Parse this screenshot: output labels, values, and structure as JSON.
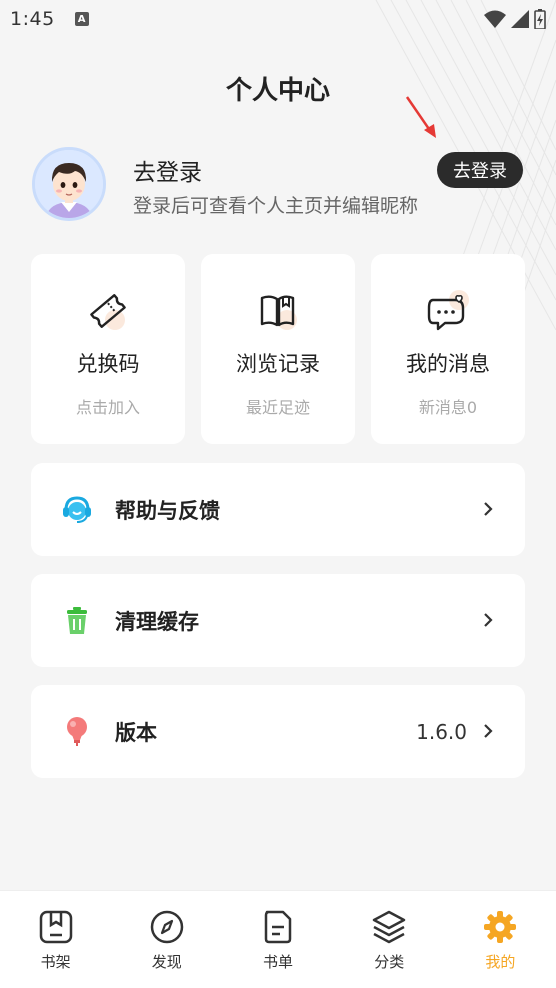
{
  "status": {
    "time": "1:45",
    "notif_letter": "A"
  },
  "header": {
    "title": "个人中心"
  },
  "profile": {
    "name": "去登录",
    "subtitle": "登录后可查看个人主页并编辑昵称",
    "login_button": "去登录"
  },
  "quick_cards": [
    {
      "icon": "ticket-icon",
      "title": "兑换码",
      "sub": "点击加入"
    },
    {
      "icon": "book-open-icon",
      "title": "浏览记录",
      "sub": "最近足迹"
    },
    {
      "icon": "message-heart-icon",
      "title": "我的消息",
      "sub": "新消息0"
    }
  ],
  "menu": [
    {
      "icon": "headset-icon",
      "label": "帮助与反馈",
      "value": ""
    },
    {
      "icon": "trash-icon",
      "label": "清理缓存",
      "value": ""
    },
    {
      "icon": "lightbulb-icon",
      "label": "版本",
      "value": "1.6.0"
    }
  ],
  "tabs": [
    {
      "icon": "bookshelf-icon",
      "label": "书架"
    },
    {
      "icon": "compass-icon",
      "label": "发现"
    },
    {
      "icon": "booklist-icon",
      "label": "书单"
    },
    {
      "icon": "layers-icon",
      "label": "分类"
    },
    {
      "icon": "gear-icon",
      "label": "我的",
      "active": true
    }
  ],
  "colors": {
    "accent": "#f5a623",
    "dark_button": "#2b2b2b",
    "arrow": "#e53935"
  }
}
